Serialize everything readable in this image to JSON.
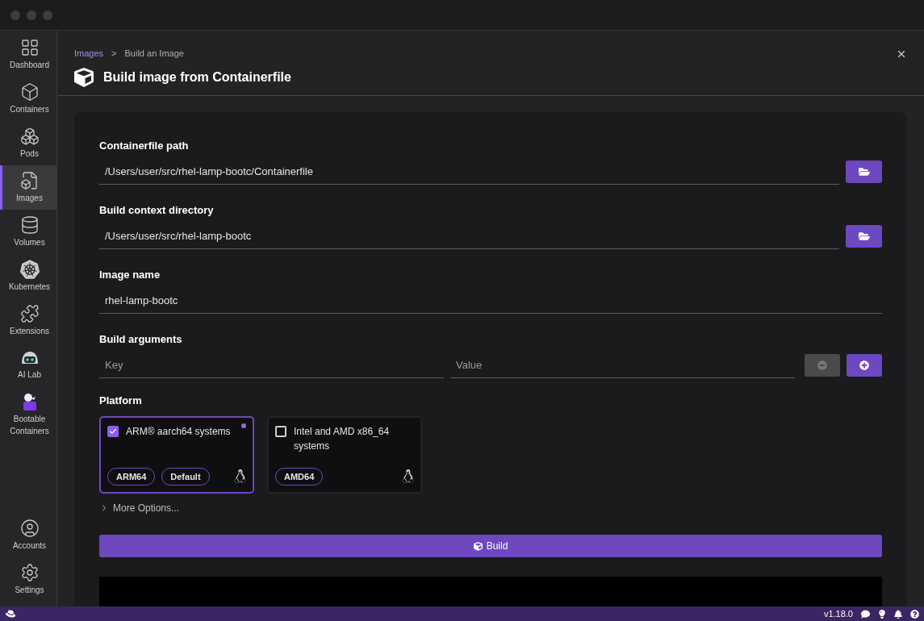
{
  "sidebar": {
    "items": [
      {
        "label": "Dashboard",
        "kind": "dashboard",
        "selected": false
      },
      {
        "label": "Containers",
        "kind": "containers",
        "selected": false
      },
      {
        "label": "Pods",
        "kind": "pods",
        "selected": false
      },
      {
        "label": "Images",
        "kind": "images",
        "selected": true
      },
      {
        "label": "Volumes",
        "kind": "volumes",
        "selected": false
      },
      {
        "label": "Kubernetes",
        "kind": "kubernetes",
        "selected": false
      },
      {
        "label": "Extensions",
        "kind": "extensions",
        "selected": false
      },
      {
        "label": "AI Lab",
        "kind": "ailab",
        "selected": false
      },
      {
        "label": "Bootable Containers",
        "kind": "bootable",
        "selected": false
      }
    ],
    "bottom_items": [
      {
        "label": "Accounts",
        "kind": "accounts",
        "selected": false
      },
      {
        "label": "Settings",
        "kind": "settings",
        "selected": false
      }
    ]
  },
  "breadcrumb": {
    "link": "Images",
    "separator": ">",
    "current": "Build an Image"
  },
  "title": "Build image from Containerfile",
  "form": {
    "containerfile_path": {
      "label": "Containerfile path",
      "value": "/Users/user/src/rhel-lamp-bootc/Containerfile"
    },
    "build_context": {
      "label": "Build context directory",
      "value": "/Users/user/src/rhel-lamp-bootc"
    },
    "image_name": {
      "label": "Image name",
      "value": "rhel-lamp-bootc"
    },
    "build_arguments": {
      "label": "Build arguments",
      "key_placeholder": "Key",
      "value_placeholder": "Value",
      "remove_disabled": true
    },
    "platform": {
      "label": "Platform",
      "options": [
        {
          "label": "ARM® aarch64 systems",
          "checked": true,
          "selected": true,
          "tags": [
            "ARM64",
            "Default"
          ]
        },
        {
          "label": "Intel and AMD x86_64 systems",
          "checked": false,
          "selected": false,
          "tags": [
            "AMD64"
          ]
        }
      ]
    },
    "more_options": {
      "label": "More Options...",
      "expanded": false
    },
    "build_button": "Build"
  },
  "status_bar": {
    "version": "v1.18.0"
  }
}
